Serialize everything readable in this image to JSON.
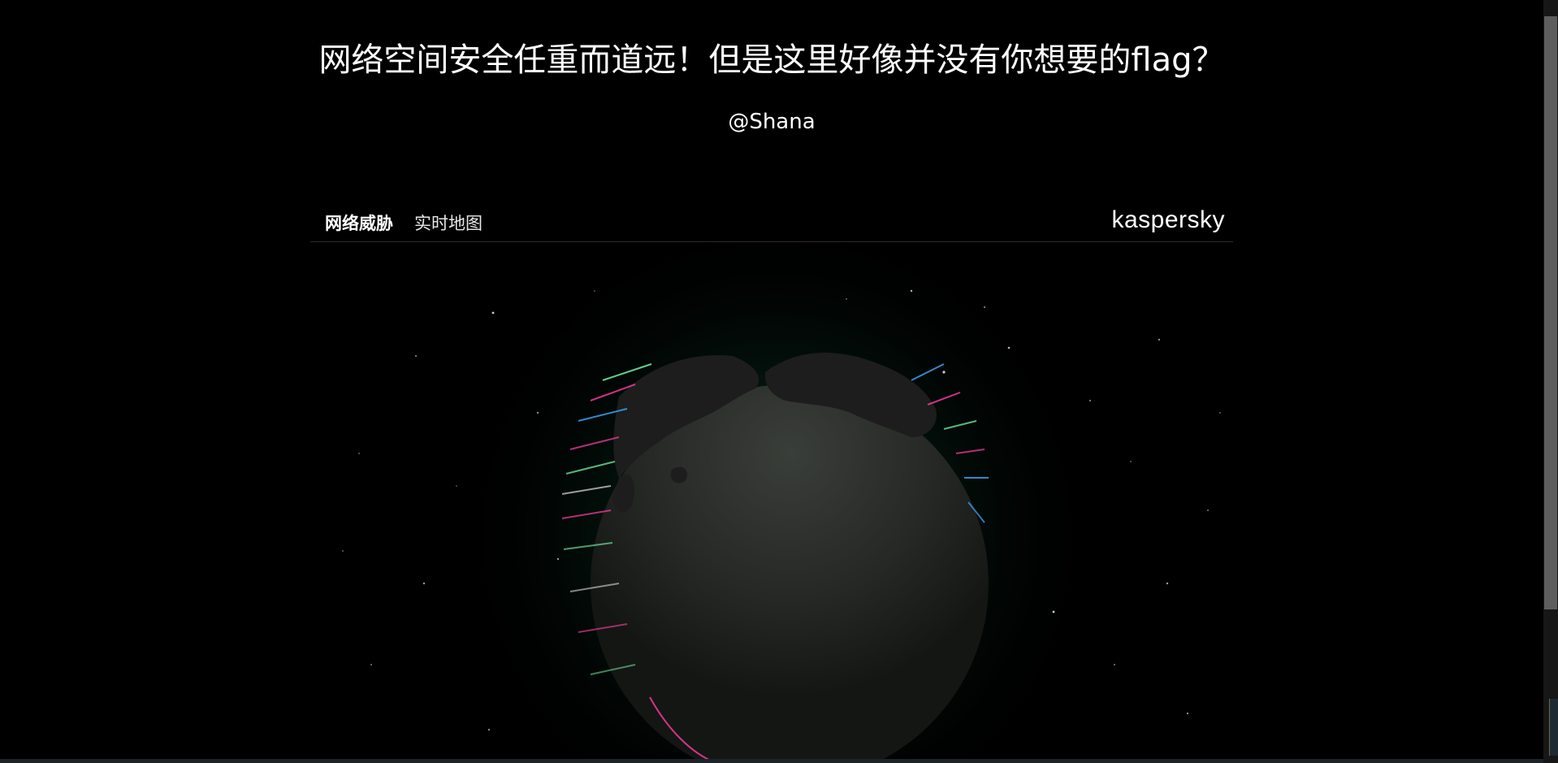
{
  "page": {
    "headline": "网络空间安全任重而道远！但是这里好像并没有你想要的flag？",
    "author": "@Shana"
  },
  "map_widget": {
    "title_bold": "网络威胁",
    "title_light": "实时地图",
    "brand": "kaspersky",
    "globe_icon": "globe-icon"
  },
  "colors": {
    "background": "#000000",
    "glow": "#0f5a3a",
    "globe": "#2a2d29",
    "attack_pink": "#ff3ea5",
    "attack_blue": "#3ea8ff",
    "attack_green": "#7dffb0"
  }
}
